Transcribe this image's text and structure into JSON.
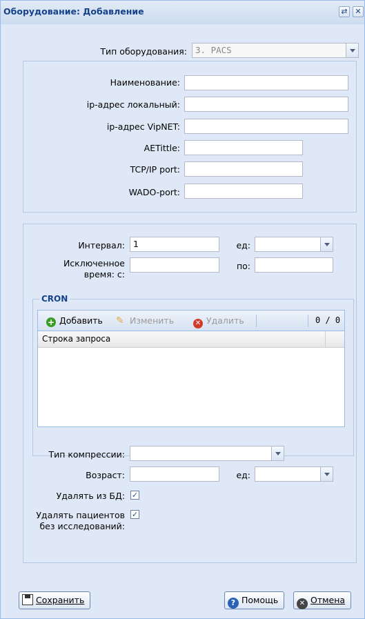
{
  "window": {
    "title": "Оборудование: Добавление",
    "refresh_icon": "refresh-icon",
    "close_icon": "close-icon"
  },
  "equipment_type": {
    "label": "Тип оборудования:",
    "value": "3. PACS"
  },
  "connection": {
    "name_label": "Наименование:",
    "name_value": "",
    "ip_local_label": "ip-адрес локальный:",
    "ip_local_value": "",
    "ip_vipnet_label": "ip-адрес VipNET:",
    "ip_vipnet_value": "",
    "aetitle_label": "AETittle:",
    "aetitle_value": "",
    "tcp_label": "TCP/IP port:",
    "tcp_value": "",
    "wado_label": "WADO-port:",
    "wado_value": ""
  },
  "schedule": {
    "interval_label": "Интервал:",
    "interval_value": "1",
    "unit_label": "ед:",
    "unit_value": "",
    "excluded_label": "Исключенное время: с:",
    "excluded_from_value": "",
    "to_label": "по:",
    "excluded_to_value": ""
  },
  "cron": {
    "legend": "CRON",
    "add_label": "Добавить",
    "edit_label": "Изменить",
    "delete_label": "Удалить",
    "counter": "0 / 0",
    "column_header": "Строка запроса",
    "rows": []
  },
  "compression": {
    "type_label": "Тип компрессии:",
    "type_value": "",
    "age_label": "Возраст:",
    "age_value": "",
    "age_unit_label": "ед:",
    "age_unit_value": "",
    "delete_db_label": "Удалять из БД:",
    "delete_db_checked": true,
    "delete_patients_label": "Удалять пациентов без исследований:",
    "delete_patients_checked": true
  },
  "footer": {
    "save_label": "Сохранить",
    "help_label": "Помощь",
    "cancel_label": "Отмена"
  },
  "colors": {
    "title": "#15428b",
    "panel_bg": "#dfe8f6",
    "border": "#99bbe8",
    "add_icon": "#3a9d23",
    "delete_icon": "#d13b2a",
    "help_icon": "#2a62b8"
  }
}
